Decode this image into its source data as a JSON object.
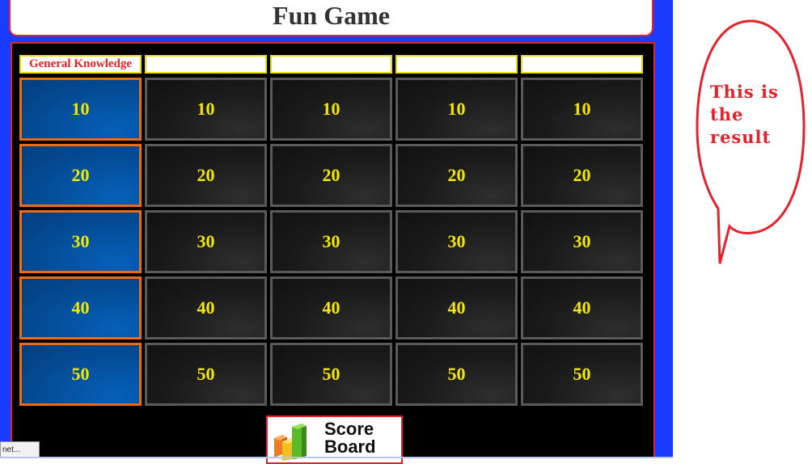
{
  "title": "Fun Game",
  "categories": [
    "General Knowledge",
    "",
    "",
    "",
    ""
  ],
  "rows": [
    [
      "10",
      "10",
      "10",
      "10",
      "10"
    ],
    [
      "20",
      "20",
      "20",
      "20",
      "20"
    ],
    [
      "30",
      "30",
      "30",
      "30",
      "30"
    ],
    [
      "40",
      "40",
      "40",
      "40",
      "40"
    ],
    [
      "50",
      "50",
      "50",
      "50",
      "50"
    ]
  ],
  "score_board": {
    "line1": "Score",
    "line2": "Board"
  },
  "annotation": {
    "line1": "This is",
    "line2": "the",
    "line3": "result"
  },
  "status_tab": "net...",
  "colors": {
    "frame_blue": "#1a3cff",
    "accent_red": "#e8202a",
    "value_yellow": "#f5e800",
    "category_border_orange": "#f06a10",
    "category_cell_blue": "#044c96",
    "cell_border_gray": "#5a5a5a"
  }
}
